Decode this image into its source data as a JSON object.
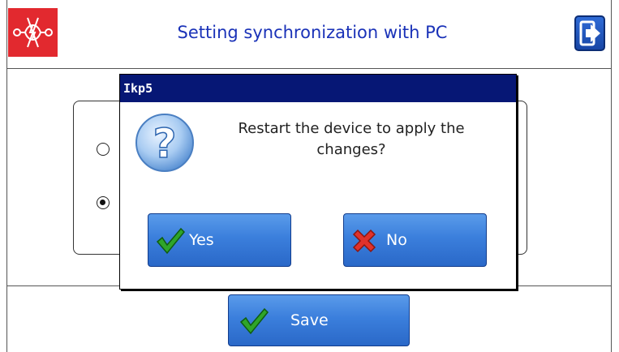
{
  "header": {
    "title": "Setting synchronization with PC",
    "logo_icon": "device-logo-icon",
    "exit_icon": "exit-arrow-icon"
  },
  "options": {
    "radio_1_selected": false,
    "radio_2_selected": true
  },
  "footer": {
    "save_label": "Save"
  },
  "dialog": {
    "title": "Ikp5",
    "message": "Restart the device to apply the changes?",
    "yes_label": "Yes",
    "no_label": "No"
  },
  "colors": {
    "accent": "#1a32b8",
    "logo_bg": "#e2292f",
    "dialog_titlebar": "#061775",
    "button_blue": "#3b7fdc"
  }
}
